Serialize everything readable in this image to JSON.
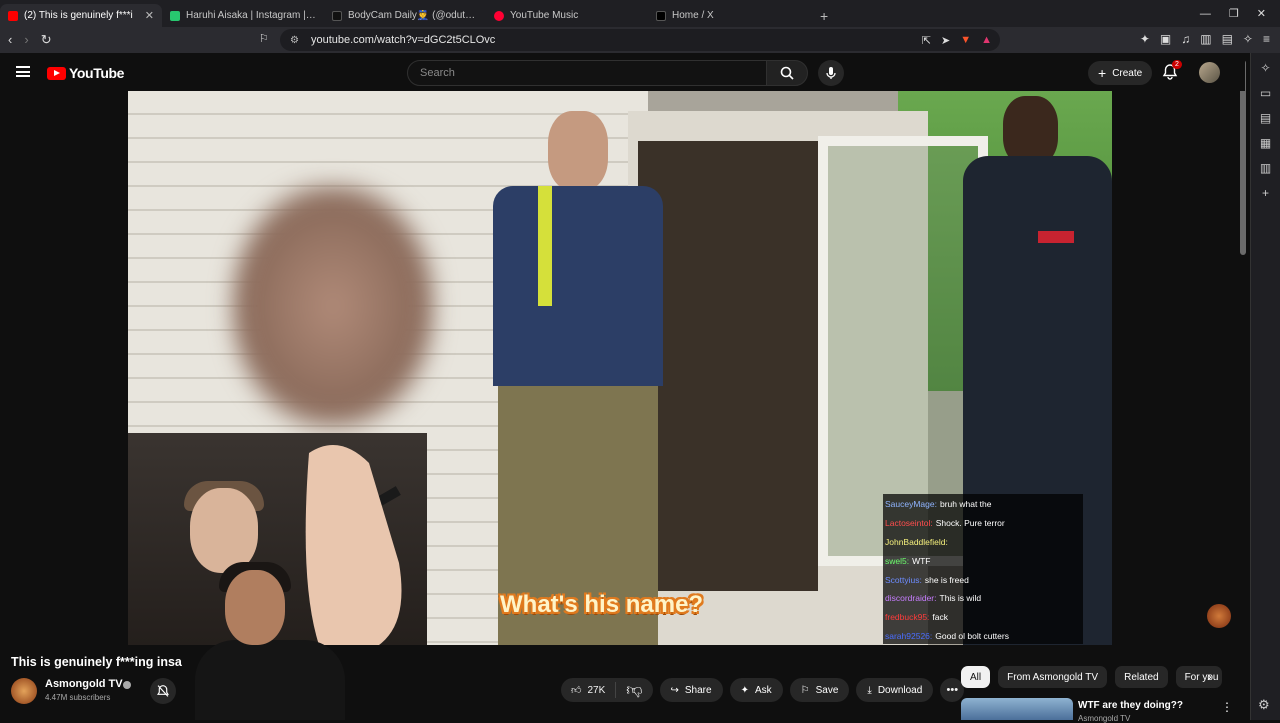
{
  "browser": {
    "tabs": [
      {
        "title": "(2) This is genuinely f***i",
        "color": "#ff0000",
        "active": true
      },
      {
        "title": "Haruhi Aisaka | Instagram | Lin",
        "color": "#28c76f",
        "active": false
      },
      {
        "title": "BodyCam Daily👮 (@odutqgp71",
        "color": "#111111",
        "active": false
      },
      {
        "title": "YouTube Music",
        "color": "#ff0033",
        "active": false
      },
      {
        "title": "Home / X",
        "color": "#000000",
        "active": false
      }
    ],
    "url": "youtube.com/watch?v=dGC2t5CLOvc"
  },
  "masthead": {
    "logo_text": "YouTube",
    "search_placeholder": "Search",
    "create_label": "Create",
    "notification_count": "2"
  },
  "video": {
    "subtitle": "What's his name?",
    "chat": [
      {
        "user": "SauceyMage:",
        "color": "#8fb4ff",
        "message": "bruh what the"
      },
      {
        "user": "Lactoseintol:",
        "color": "#ff4d4d",
        "message": "Shock. Pure terror"
      },
      {
        "user": "JohnBaddlefield:",
        "color": "#f6f17d",
        "message": ""
      },
      {
        "user": "swel5:",
        "color": "#6cff6c",
        "message": "WTF"
      },
      {
        "user": "Scottyius:",
        "color": "#6d8cff",
        "message": "she is freed"
      },
      {
        "user": "discordraider:",
        "color": "#c77dff",
        "message": "This is wild"
      },
      {
        "user": "fredbuck95:",
        "color": "#ff3b3b",
        "message": "fack"
      },
      {
        "user": "sarah92526:",
        "color": "#4a6dff",
        "message": "Good ol bolt cutters"
      }
    ]
  },
  "watch": {
    "title": "This is genuinely f***ing insa",
    "channel": "Asmongold TV",
    "subscribers": "4.47M subscribers",
    "likes": "27K",
    "share_label": "Share",
    "ask_label": "Ask",
    "save_label": "Save",
    "download_label": "Download"
  },
  "related": {
    "chips": [
      {
        "label": "All",
        "active": true
      },
      {
        "label": "From Asmongold TV",
        "active": false
      },
      {
        "label": "Related",
        "active": false
      },
      {
        "label": "For you",
        "active": false
      }
    ],
    "items": [
      {
        "title": "WTF are they doing??",
        "channel": "Asmongold TV"
      }
    ]
  },
  "colors": {
    "accent": "#ff0000",
    "background": "#0f0f0f",
    "chip_active": "#f1f1f1"
  }
}
